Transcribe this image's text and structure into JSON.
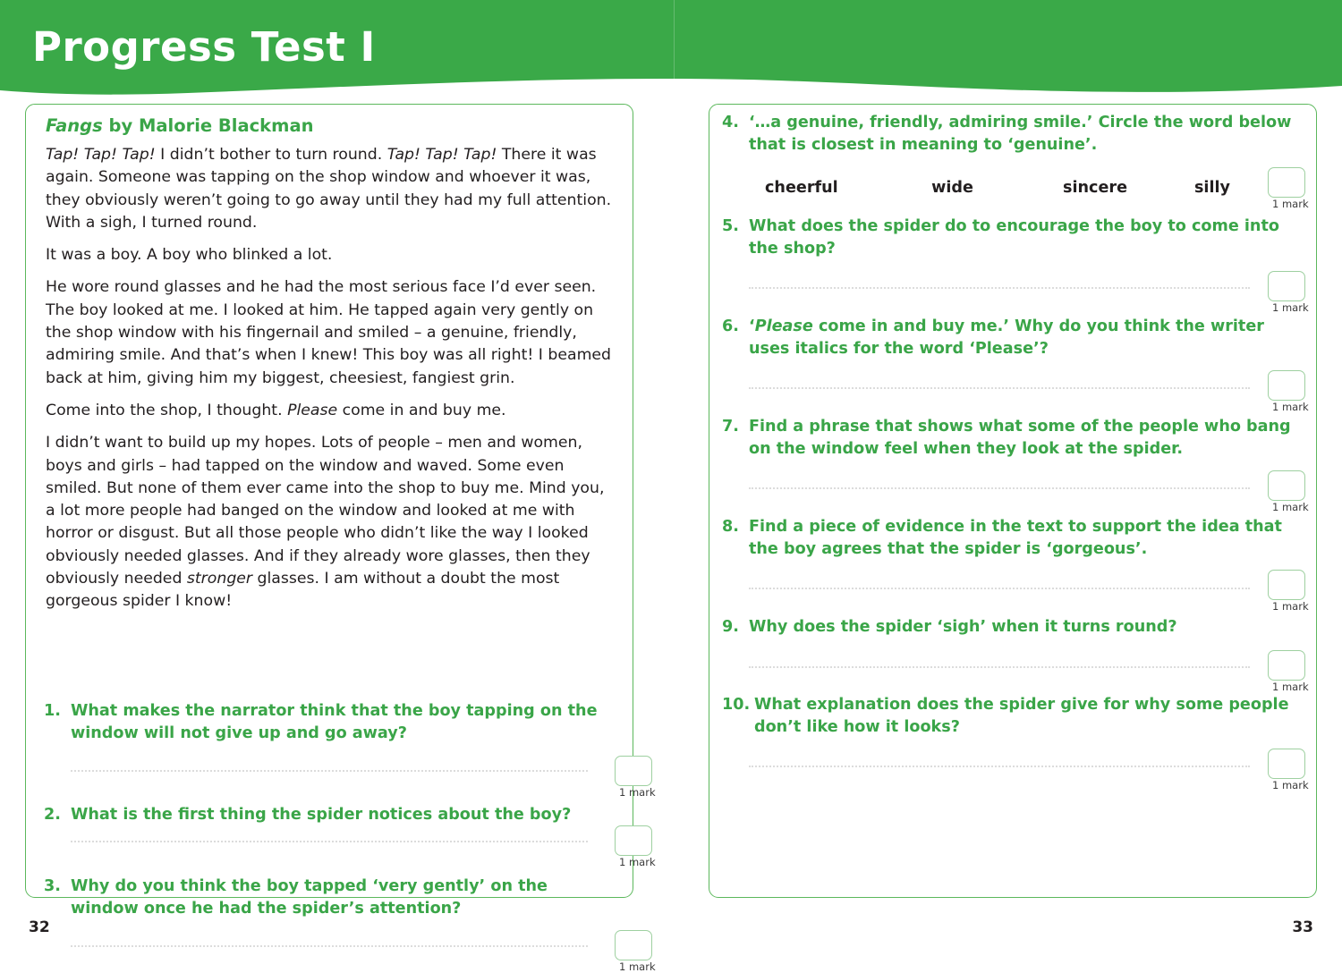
{
  "header": {
    "title": "Progress Test I",
    "background_color": "#3aa948",
    "title_color": "#ffffff"
  },
  "theme": {
    "green": "#3aa548",
    "border_green": "#5cb85c",
    "markbox_green": "#9ed0a0",
    "body_text": "#231f20",
    "rule_gray": "#dcdcdc"
  },
  "left_page": {
    "page_number": "32",
    "passage": {
      "title_italic": "Fangs",
      "title_rest": " by Malorie Blackman",
      "paragraphs": [
        "<i>Tap! Tap! Tap!</i> I didn’t bother to turn round. <i>Tap! Tap! Tap!</i> There it was again. Someone was tapping on the shop window and whoever it was, they obviously weren’t going to go away until they had my full attention. With a sigh, I turned round.",
        "It was a boy. A boy who blinked a lot.",
        "He wore round glasses and he had the most serious face I’d ever seen. The boy looked at me. I looked at him. He tapped again very gently on the shop window with his fingernail and smiled – a genuine, friendly, admiring smile. And that’s when I knew! This boy was all right! I beamed back at him, giving him my biggest, cheesiest, fangiest grin.",
        "Come into the shop, I thought. <i>Please</i> come in and buy me.",
        "I didn’t want to build up my hopes. Lots of people – men and women, boys and girls – had tapped on the window and waved. Some even smiled. But none of them ever came into the shop to buy me. Mind you, a lot more people had banged on the window and looked at me with horror or disgust. But all those people who didn’t like the way I looked obviously needed glasses. And if they already wore glasses, then they obviously needed <i>stronger</i> glasses. I am without a doubt the most gorgeous spider I know!"
      ]
    },
    "questions": [
      {
        "number": "1.",
        "text": "What makes the narrator think that the boy tapping on the window will not give up and go away?",
        "mark_label": "1 mark"
      },
      {
        "number": "2.",
        "text": "What is the first thing the spider notices about the boy?",
        "mark_label": "1 mark"
      },
      {
        "number": "3.",
        "text": "Why do you think the boy tapped ‘very gently’ on the window once he had the spider’s attention?",
        "mark_label": "1 mark"
      }
    ]
  },
  "right_page": {
    "page_number": "33",
    "questions": [
      {
        "number": "4.",
        "text": "‘…a genuine, friendly, admiring smile.’ Circle the word below that is closest in meaning to ‘genuine’.",
        "options": [
          "cheerful",
          "wide",
          "sincere",
          "silly"
        ],
        "mark_label": "1 mark"
      },
      {
        "number": "5.",
        "text": "What does the spider do to encourage the boy to come into the shop?",
        "mark_label": "1 mark"
      },
      {
        "number": "6.",
        "text": "‘<i>Please</i> come in and buy me.’ Why do you think the writer uses italics for the word ‘Please’?",
        "mark_label": "1 mark"
      },
      {
        "number": "7.",
        "text": "Find a phrase that shows what some of the people who bang on the window feel when they look at the spider.",
        "mark_label": "1 mark"
      },
      {
        "number": "8.",
        "text": "Find a piece of evidence in the text to support the idea that the boy agrees that the spider is ‘gorgeous’.",
        "mark_label": "1 mark"
      },
      {
        "number": "9.",
        "text": "Why does the spider ‘sigh’ when it turns round?",
        "mark_label": "1 mark"
      },
      {
        "number": "10.",
        "text": "What explanation does the spider give for why some people don’t like how it looks?",
        "mark_label": "1 mark"
      }
    ]
  }
}
